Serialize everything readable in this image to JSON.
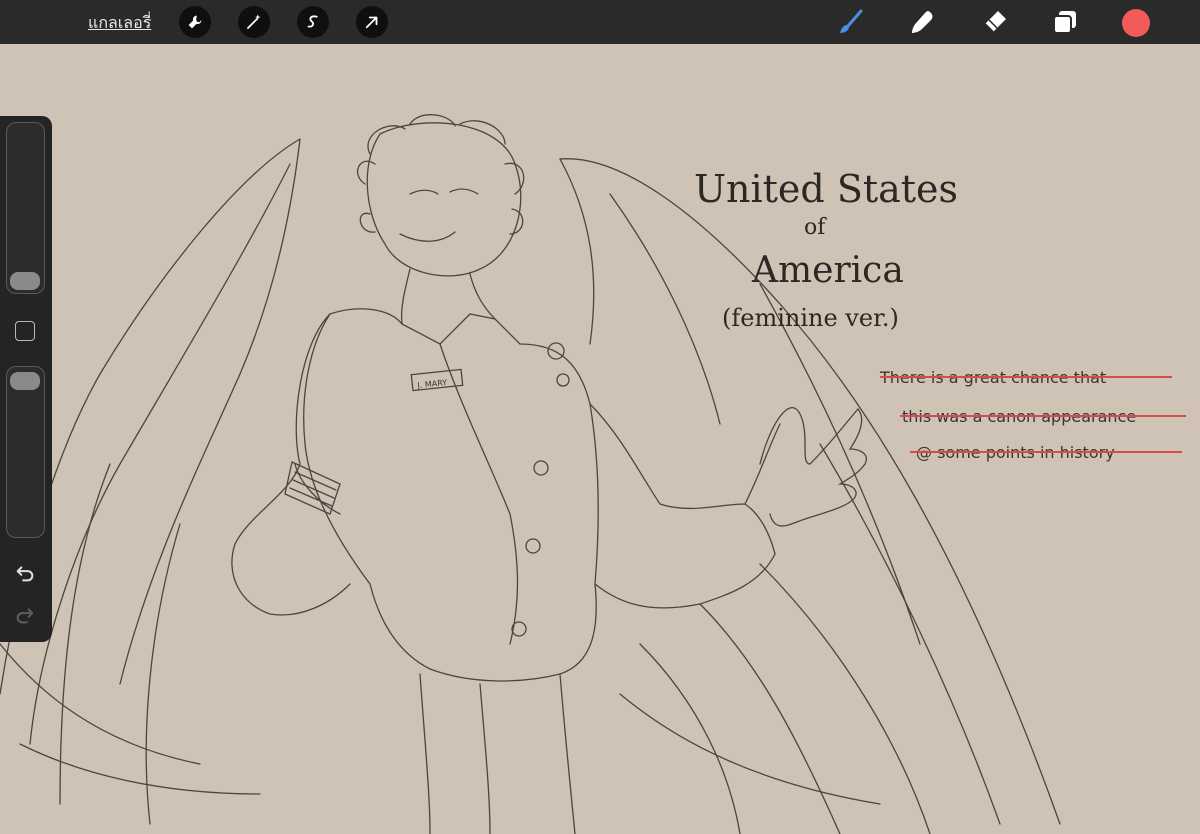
{
  "topbar": {
    "gallery_label": "แกลเลอรี่",
    "left_tools": [
      "wrench-icon",
      "magic-wand-icon",
      "selection-icon",
      "transform-arrow-icon"
    ],
    "right_tools": [
      "brush-icon",
      "smudge-icon",
      "eraser-icon",
      "layers-icon"
    ],
    "current_color": "#f25a5a",
    "active_tool_color": "#4a90e2"
  },
  "sidebar": {
    "size_slider_value": 0.05,
    "opacity_slider_value": 0.97
  },
  "canvas": {
    "background": "#cfc3b5",
    "title_line1": "United States",
    "title_line2": "of",
    "title_line3": "America",
    "title_line4": "(feminine ver.)",
    "note_line1": "There is a great chance that",
    "note_line2": "this was a canon appearance",
    "note_line3": "@ some points in history",
    "badge_text": "J. MARY"
  }
}
